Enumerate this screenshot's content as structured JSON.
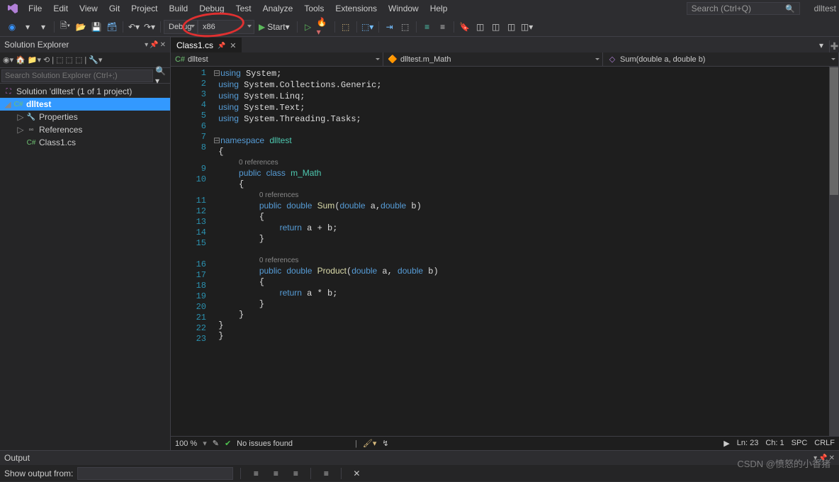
{
  "menubar": {
    "items": [
      "File",
      "Edit",
      "View",
      "Git",
      "Project",
      "Build",
      "Debug",
      "Test",
      "Analyze",
      "Tools",
      "Extensions",
      "Window",
      "Help"
    ],
    "search_placeholder": "Search (Ctrl+Q)",
    "solution_name": "dlltest"
  },
  "toolbar": {
    "config": "Debug",
    "platform": "x86",
    "start": "Start"
  },
  "solution_explorer": {
    "title": "Solution Explorer",
    "search_placeholder": "Search Solution Explorer (Ctrl+;)",
    "solution": "Solution 'dlltest' (1 of 1 project)",
    "project": "dlltest",
    "nodes": [
      "Properties",
      "References",
      "Class1.cs"
    ]
  },
  "editor": {
    "tab": "Class1.cs",
    "nav1": "dlltest",
    "nav2": "dlltest.m_Math",
    "nav3": "Sum(double a, double b)",
    "line_numbers": [
      "1",
      "2",
      "3",
      "4",
      "5",
      "6",
      "7",
      "8",
      "",
      "9",
      "10",
      "",
      "11",
      "12",
      "13",
      "14",
      "15",
      "",
      "16",
      "17",
      "18",
      "19",
      "20",
      "21",
      "22",
      "23"
    ],
    "refs": "0 references",
    "code": {
      "l1": "using System;",
      "l2": "using System.Collections.Generic;",
      "l3": "using System.Linq;",
      "l4": "using System.Text;",
      "l5": "using System.Threading.Tasks;",
      "l7": "namespace dlltest",
      "l9": "public class m_Math",
      "l11": "public double Sum(double a,double b)",
      "l13": "return a + b;",
      "l16": "public double Product(double a, double b)",
      "l18": "return a * b;"
    }
  },
  "status": {
    "zoom": "100 %",
    "issues": "No issues found",
    "ln": "Ln: 23",
    "ch": "Ch: 1",
    "spc": "SPC",
    "eol": "CRLF"
  },
  "output": {
    "title": "Output",
    "label": "Show output from:"
  },
  "watermark": "CSDN @愤怒的小香猪"
}
